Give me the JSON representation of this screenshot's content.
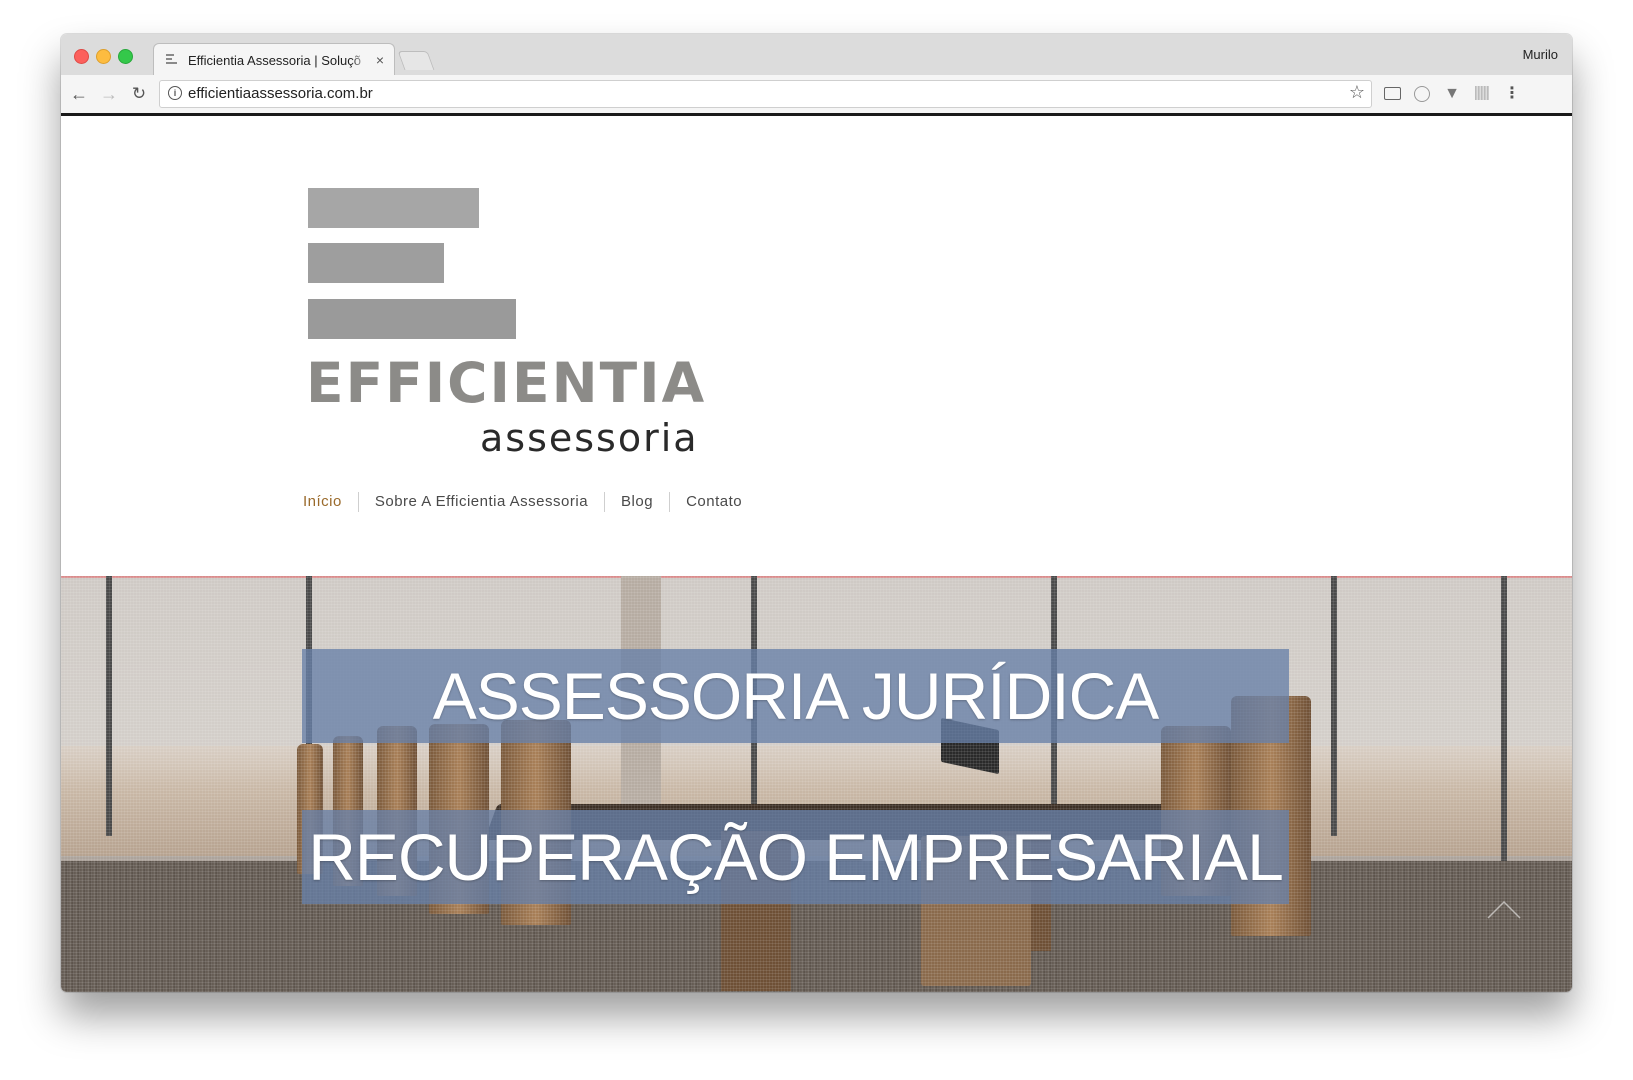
{
  "browser": {
    "tab_title": "Efficientia Assessoria | Soluçõ",
    "tab_close": "×",
    "profile_name": "Murilo",
    "url": "efficientiaassessoria.com.br",
    "icons": {
      "back": "arrow-left-icon",
      "forward": "arrow-right-icon",
      "reload": "reload-icon",
      "info": "info-icon",
      "bookmark": "star-icon",
      "cast": "cast-icon",
      "extension1": "circle-extension-icon",
      "extension2": "v-extension-icon",
      "extension3": "grid-extension-icon",
      "menu": "kebab-menu-icon"
    }
  },
  "logo": {
    "wordmark": "EFFICIENTIA",
    "sub": "assessoria"
  },
  "nav": {
    "items": [
      {
        "label": "Início",
        "active": true
      },
      {
        "label": "Sobre A Efficientia Assessoria",
        "active": false
      },
      {
        "label": "Blog",
        "active": false
      },
      {
        "label": "Contato",
        "active": false
      }
    ]
  },
  "hero": {
    "line1": "ASSESSORIA JURÍDICA",
    "line2": "RECUPERAÇÃO EMPRESARIAL"
  },
  "colors": {
    "active_nav": "#9a6a2b",
    "banner": "#6880a8",
    "logo_grey": "#8c8b88"
  }
}
